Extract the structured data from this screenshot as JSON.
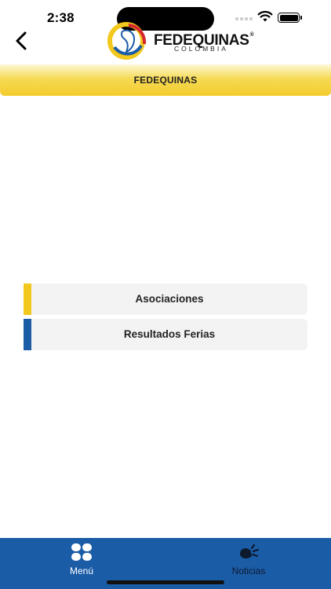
{
  "status": {
    "time": "2:38"
  },
  "brand": {
    "name": "FEDEQUINAS",
    "registered": "®",
    "subtitle": "COLOMBIA"
  },
  "header": {
    "title": "FEDEQUINAS"
  },
  "menu": {
    "items": [
      {
        "label": "Asociaciones",
        "accent": "#f2c81c"
      },
      {
        "label": "Resultados Ferias",
        "accent": "#1b5ca7"
      }
    ]
  },
  "tabbar": {
    "items": [
      {
        "label": "Menú",
        "icon": "grid-icon",
        "active": false
      },
      {
        "label": "Noticias",
        "icon": "megaphone-icon",
        "active": true
      }
    ]
  },
  "colors": {
    "primary_blue": "#1b5ca7",
    "brand_yellow": "#f2c81c",
    "brand_red": "#d62630"
  }
}
